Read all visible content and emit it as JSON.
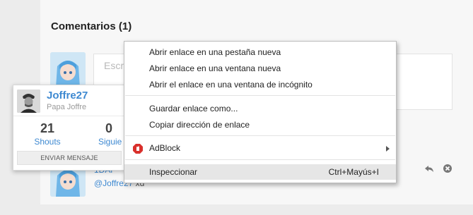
{
  "comments_section": {
    "title": "Comentarios (1)",
    "input_placeholder": "Escr"
  },
  "reply": {
    "name_visible": "1DAr",
    "mention": "@Joffre27",
    "text": " xd"
  },
  "profile_card": {
    "username": "Joffre27",
    "subtitle": "Papa Joffre",
    "stats": [
      {
        "value": "21",
        "label": "Shouts"
      },
      {
        "value": "0",
        "label": "Siguie"
      }
    ],
    "button_label": "ENVIAR MENSAJE"
  },
  "context_menu": {
    "items": [
      {
        "label": "Abrir enlace en una pestaña nueva"
      },
      {
        "label": "Abrir enlace en una ventana nueva"
      },
      {
        "label": "Abrir el enlace en una ventana de incógnito"
      },
      {
        "label": "Guardar enlace como..."
      },
      {
        "label": "Copiar dirección de enlace"
      },
      {
        "label": "AdBlock",
        "icon": "adblock-icon",
        "has_submenu": true
      },
      {
        "label": "Inspeccionar",
        "shortcut": "Ctrl+Mayús+I",
        "highlighted": true
      }
    ]
  },
  "colors": {
    "link": "#3e89d1",
    "adblock_red": "#d9302c"
  }
}
